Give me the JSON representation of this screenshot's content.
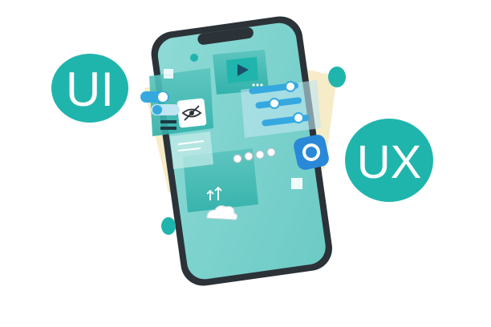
{
  "badges": {
    "ui": {
      "text": "UI"
    },
    "ux": {
      "text": "UX"
    }
  },
  "colors": {
    "teal": "#1fb5ad",
    "teal_dark": "#159b94",
    "screen": "#7fd3cf",
    "phone_frame": "#2b3238",
    "cream": "#f3e6b5",
    "blue": "#2a88d8",
    "white": "#ffffff"
  },
  "icons": [
    "play-icon",
    "hidden-eye-icon",
    "upload-arrows-icon",
    "cloud-icon",
    "toggle-icon",
    "slider-icon"
  ]
}
